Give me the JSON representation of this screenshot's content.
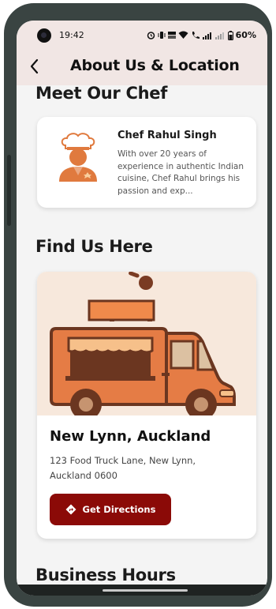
{
  "status_bar": {
    "time": "19:42",
    "battery": "60%",
    "icons": [
      "alarm-icon",
      "vibrate-icon",
      "data-speed-icon",
      "wifi-icon",
      "call-icon",
      "signal-icon",
      "battery-icon"
    ]
  },
  "header": {
    "title": "About Us & Location",
    "back_icon": "chevron-left-icon",
    "background": "#f1e6e4"
  },
  "chef_section": {
    "title": "Meet Our Chef",
    "chef_name": "Chef Rahul Singh",
    "bio": "With over 20 years of experience in authentic Indian cuisine, Chef Rahul brings his passion and exp..."
  },
  "location_section": {
    "title": "Find Us Here",
    "image": "food-truck-illustration",
    "location_name": "New Lynn, Auckland",
    "address_line1": "123 Food Truck Lane, New Lynn,",
    "address_line2": "Auckland 0600",
    "directions_label": "Get Directions",
    "directions_icon": "directions-icon",
    "accent": "#8b0a07"
  },
  "hours_section": {
    "title": "Business Hours"
  }
}
